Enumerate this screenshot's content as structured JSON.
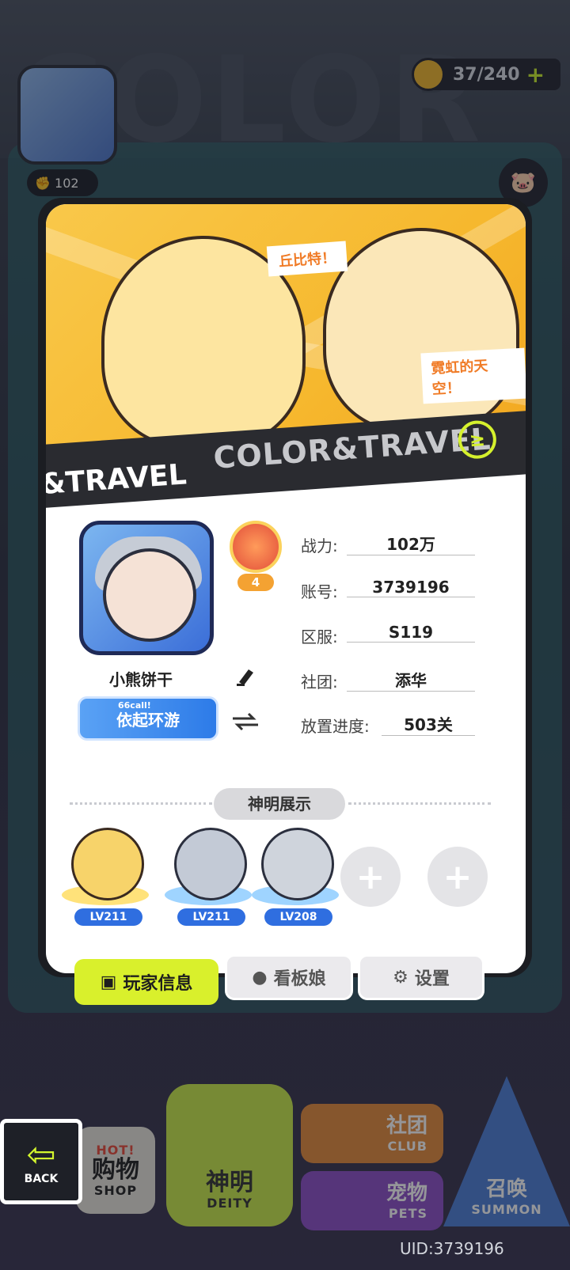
{
  "background": {
    "watermark_word": "COLOR",
    "currency": {
      "value": "37/240",
      "plus": "+"
    },
    "power_chip": "102",
    "side_icon": "pig-icon"
  },
  "card": {
    "banner": {
      "bubble_1": "丘比特！",
      "bubble_2": "霓虹的天空！",
      "stripe_text": "COLOR&TRAVEL",
      "stripe_left_text": "&TRAVEL",
      "stripe_logo": "≥"
    },
    "profile": {
      "name": "小熊饼干",
      "rank_level": "4",
      "title_badge": "依起环游",
      "title_badge_small": "66call!"
    },
    "stats": [
      {
        "label": "战力:",
        "value": "102万"
      },
      {
        "label": "账号:",
        "value": "3739196"
      },
      {
        "label": "区服:",
        "value": "S119"
      },
      {
        "label": "社团:",
        "value": "添华"
      },
      {
        "label": "放置进度:",
        "value": "503关"
      }
    ],
    "deity_section": {
      "label": "神明展示",
      "deities": [
        {
          "level": "LV211"
        },
        {
          "level": "LV211"
        },
        {
          "level": "LV208"
        }
      ],
      "empty_slot_symbol": "+"
    }
  },
  "tabs": {
    "player_info": "玩家信息",
    "mascot": "看板娘",
    "settings": "设置"
  },
  "bottom_nav": {
    "back": "BACK",
    "shop_cn": "购物",
    "shop_en": "SHOP",
    "shop_hot": "HOT!",
    "deity_cn": "神明",
    "deity_en": "DEITY",
    "club_cn": "社团",
    "club_en": "CLUB",
    "pets_cn": "宠物",
    "pets_en": "PETS",
    "summon_cn": "召唤",
    "summon_en": "SUMMON"
  },
  "uid": "UID:3739196",
  "colors": {
    "accent": "#d9f02c",
    "banner": "#f6b82e",
    "badge": "#2d7be8"
  }
}
